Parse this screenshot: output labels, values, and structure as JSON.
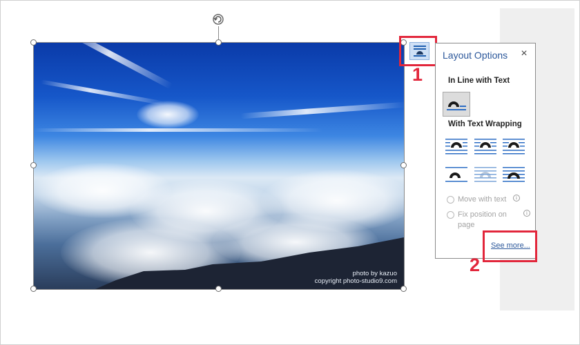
{
  "image": {
    "credit_line1": "photo by kazuo",
    "credit_line2": "copyright photo-studio9.com"
  },
  "layout_options": {
    "title": "Layout Options",
    "close_glyph": "×",
    "in_line_heading": "In Line with Text",
    "wrapping_heading": "With Text Wrapping",
    "move_with_text": "Move with text",
    "fix_position_line1": "Fix position on",
    "fix_position_line2": "page",
    "info_glyph": "i",
    "see_more": "See more..."
  },
  "annotations": {
    "step1": "1",
    "step2": "2",
    "highlight_color": "#e2263b"
  },
  "icons": {
    "rotate": "rotate-handle-icon",
    "layout": "layout-options-icon",
    "close": "close-icon"
  }
}
